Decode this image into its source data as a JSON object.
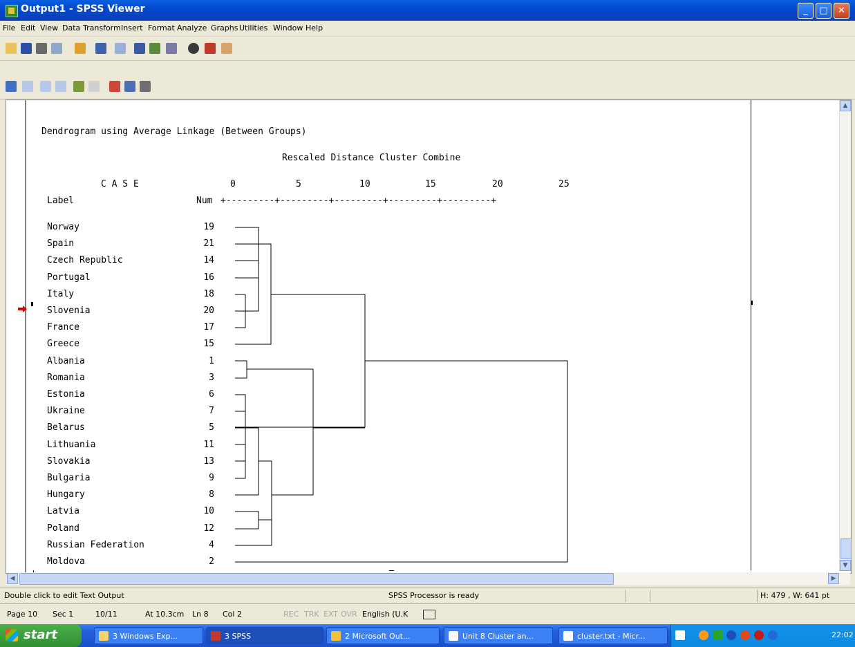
{
  "window": {
    "title": "Output1 - SPSS Viewer"
  },
  "menu": [
    "File",
    "Edit",
    "View",
    "Data",
    "Transform",
    "Insert",
    "Format",
    "Analyze",
    "Graphs",
    "Utilities",
    "Window",
    "Help"
  ],
  "dendrogram": {
    "title": "Dendrogram using Average Linkage (Between Groups)",
    "subtitle": "Rescaled Distance Cluster Combine",
    "case_header": "C A S E",
    "label_header": "Label",
    "num_header": "Num",
    "scale": [
      "0",
      "5",
      "10",
      "15",
      "20",
      "25"
    ],
    "scale_line": "+---------+---------+---------+---------+---------+",
    "cases": [
      {
        "label": "Norway",
        "num": "19"
      },
      {
        "label": "Spain",
        "num": "21"
      },
      {
        "label": "Czech Republic",
        "num": "14"
      },
      {
        "label": "Portugal",
        "num": "16"
      },
      {
        "label": "Italy",
        "num": "18"
      },
      {
        "label": "Slovenia",
        "num": "20"
      },
      {
        "label": "France",
        "num": "17"
      },
      {
        "label": "Greece",
        "num": "15"
      },
      {
        "label": "Albania",
        "num": "1"
      },
      {
        "label": "Romania",
        "num": "3"
      },
      {
        "label": "Estonia",
        "num": "6"
      },
      {
        "label": "Ukraine",
        "num": "7"
      },
      {
        "label": "Belarus",
        "num": "5"
      },
      {
        "label": "Lithuania",
        "num": "11"
      },
      {
        "label": "Slovakia",
        "num": "13"
      },
      {
        "label": "Bulgaria",
        "num": "9"
      },
      {
        "label": "Hungary",
        "num": "8"
      },
      {
        "label": "Latvia",
        "num": "10"
      },
      {
        "label": "Poland",
        "num": "12"
      },
      {
        "label": "Russian Federation",
        "num": "4"
      },
      {
        "label": "Moldova",
        "num": "2"
      }
    ]
  },
  "status": {
    "hint": "Double click to edit Text Output",
    "processor": "SPSS Processor is ready",
    "size": "H: 479 , W: 641 pt"
  },
  "word_status": {
    "page": "Page 10",
    "sec": "Sec 1",
    "pages": "10/11",
    "at": "At 10.3cm",
    "ln": "Ln 8",
    "col": "Col 2",
    "rec": "REC",
    "trk": "TRK",
    "ext": "EXT",
    "ovr": "OVR",
    "lang": "English (U.K"
  },
  "taskbar": {
    "start": "start",
    "tasks": [
      "3 Windows Exp...",
      "3 SPSS",
      "2 Microsoft Out...",
      "Unit 8 Cluster an...",
      "cluster.txt - Micr..."
    ],
    "clock": "22:02"
  }
}
